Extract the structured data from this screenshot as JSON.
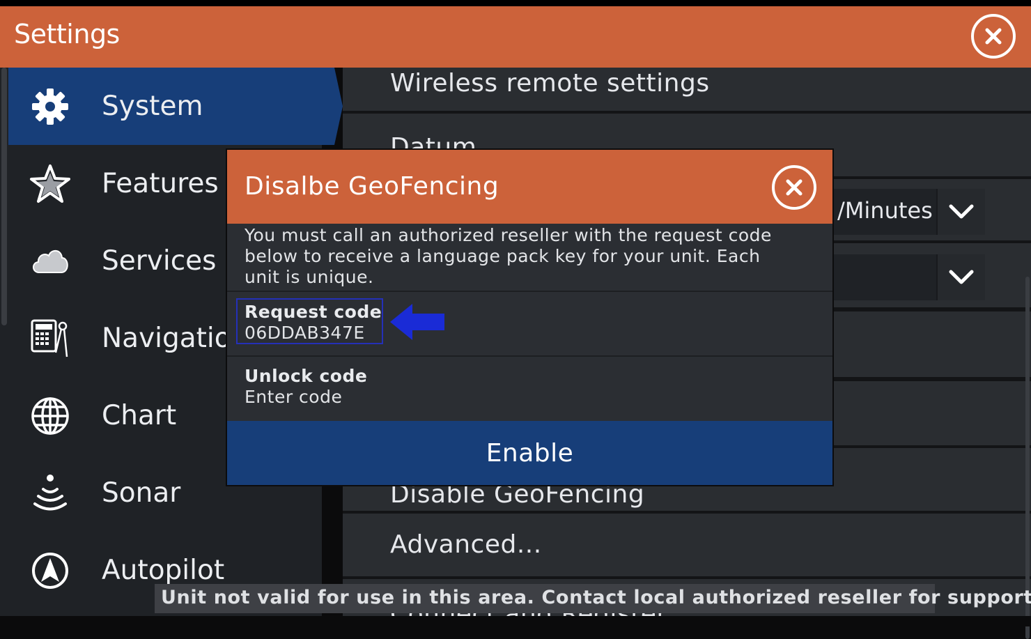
{
  "window": {
    "title": "Settings"
  },
  "sidebar": {
    "items": [
      {
        "label": "System",
        "icon": "gear-icon",
        "active": true
      },
      {
        "label": "Features",
        "icon": "star-icon"
      },
      {
        "label": "Services",
        "icon": "cloud-icon"
      },
      {
        "label": "Navigation",
        "icon": "calculator-compass-icon"
      },
      {
        "label": "Chart",
        "icon": "globe-icon"
      },
      {
        "label": "Sonar",
        "icon": "sonar-icon"
      },
      {
        "label": "Autopilot",
        "icon": "autopilot-icon"
      }
    ]
  },
  "panel": {
    "rows": [
      {
        "label": "Wireless remote settings"
      },
      {
        "label": "Datum"
      },
      {
        "label": "Disable GeoFencing"
      },
      {
        "label": "Advanced..."
      },
      {
        "label": "Connect and Register..."
      }
    ],
    "dropdowns": [
      {
        "value": "/Minutes"
      },
      {
        "value": ""
      }
    ]
  },
  "dialog": {
    "title": "Disalbe GeoFencing",
    "description": "You must call an authorized reseller with the request code below to receive a language pack key for your unit. Each unit is unique.",
    "request_code": {
      "label": "Request code",
      "value": "06DDAB347E"
    },
    "unlock_code": {
      "label": "Unlock code",
      "placeholder": "Enter code"
    },
    "enable_label": "Enable"
  },
  "toast": {
    "message": "Unit not valid for use in this area. Contact local authorized reseller for support."
  },
  "colors": {
    "titlebar": "#cc623a",
    "accent": "#173e79",
    "highlight_box": "#2430b8",
    "arrow": "#1a2bd6"
  }
}
